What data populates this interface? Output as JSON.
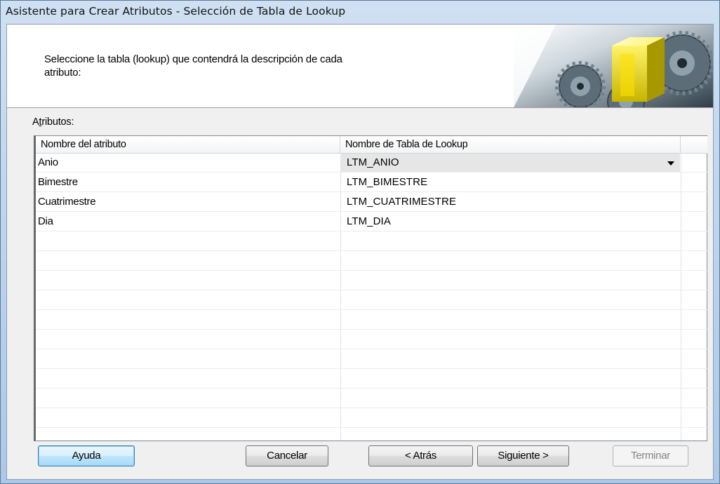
{
  "window": {
    "title": "Asistente para Crear Atributos - Selección de Tabla de Lookup"
  },
  "header": {
    "instruction_line1": "Seleccione la tabla (lookup) que contendrá la descripción de cada",
    "instruction_line2": "atributo:"
  },
  "attributes": {
    "label": "Atributos:",
    "columns": [
      "Nombre del atributo",
      "Nombre de Tabla de Lookup"
    ],
    "rows": [
      {
        "name": "Anio",
        "lookup": "LTM_ANIO"
      },
      {
        "name": "Bimestre",
        "lookup": "LTM_BIMESTRE"
      },
      {
        "name": "Cuatrimestre",
        "lookup": "LTM_CUATRIMESTRE"
      },
      {
        "name": "Dia",
        "lookup": "LTM_DIA"
      }
    ]
  },
  "buttons": {
    "help": "Ayuda",
    "cancel": "Cancelar",
    "back": "< Atrás",
    "next": "Siguiente >",
    "finish": "Terminar"
  }
}
